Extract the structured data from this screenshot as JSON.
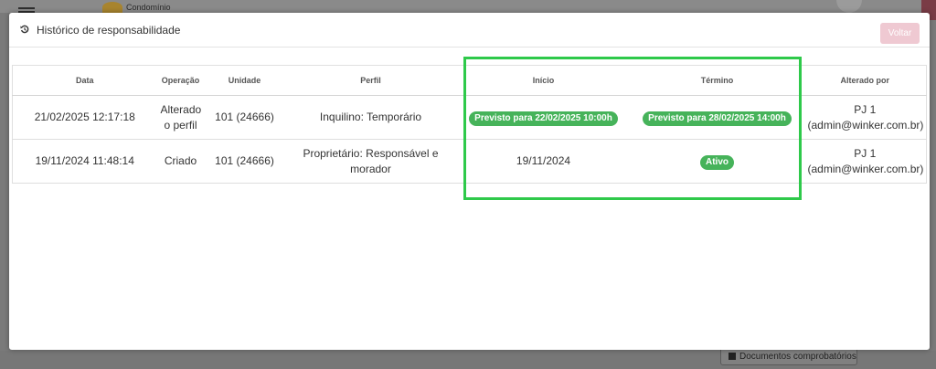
{
  "background": {
    "brand_text": "Condomínio",
    "documents_button": "Documentos comprobatórios"
  },
  "modal": {
    "title": "Histórico de responsabilidade",
    "title_icon": "history-icon",
    "back_button": "Voltar"
  },
  "table": {
    "headers": {
      "data": "Data",
      "operacao": "Operação",
      "unidade": "Unidade",
      "perfil": "Perfil",
      "inicio": "Início",
      "termino": "Término",
      "alterado_por": "Alterado por"
    },
    "rows": [
      {
        "data": "21/02/2025 12:17:18",
        "operacao": "Alterado o perfil",
        "unidade": "101 (24666)",
        "perfil": "Inquilino: Temporário",
        "inicio": "Previsto para 22/02/2025 10:00h",
        "termino": "Previsto para 28/02/2025 14:00h",
        "alterado_por_name": "PJ 1",
        "alterado_por_email": "(admin@winker.com.br)"
      },
      {
        "data": "19/11/2024 11:48:14",
        "operacao": "Criado",
        "unidade": "101 (24666)",
        "perfil": "Proprietário: Responsável e morador",
        "inicio": "19/11/2024",
        "termino": "Ativo",
        "alterado_por_name": "PJ 1",
        "alterado_por_email": "(admin@winker.com.br)"
      }
    ]
  },
  "colors": {
    "badge_green": "#46b35a",
    "highlight_green": "#2ec94a",
    "back_button": "#efc9d2"
  }
}
